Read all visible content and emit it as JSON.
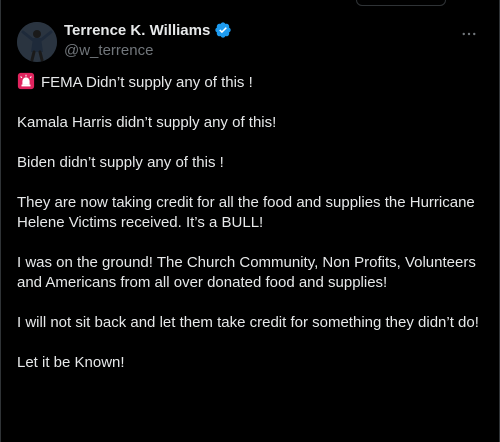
{
  "author": {
    "display_name": "Terrence K. Williams",
    "handle": "@w_terrence",
    "verified": true
  },
  "icons": {
    "more": "more-options-icon",
    "verified": "verified-badge-icon",
    "siren": "siren-emoji-icon"
  },
  "tweet": {
    "paragraphs": [
      "FEMA Didn’t supply any of this !",
      "Kamala Harris didn’t supply any of this!",
      "Biden didn’t supply any of this !",
      "They are now taking credit for all the food and supplies the Hurricane Helene Victims received. It’s a BULL!",
      "I was on the ground! The Church Community, Non Profits, Volunteers and Americans from all over donated food and supplies!",
      "I will not sit back and let them take credit for something they didn’t do!",
      "Let it be Known!"
    ]
  },
  "colors": {
    "background": "#000000",
    "text": "#e7e9ea",
    "secondary_text": "#71767b",
    "verified_blue": "#1d9bf0",
    "siren_red": "#e0245e"
  }
}
